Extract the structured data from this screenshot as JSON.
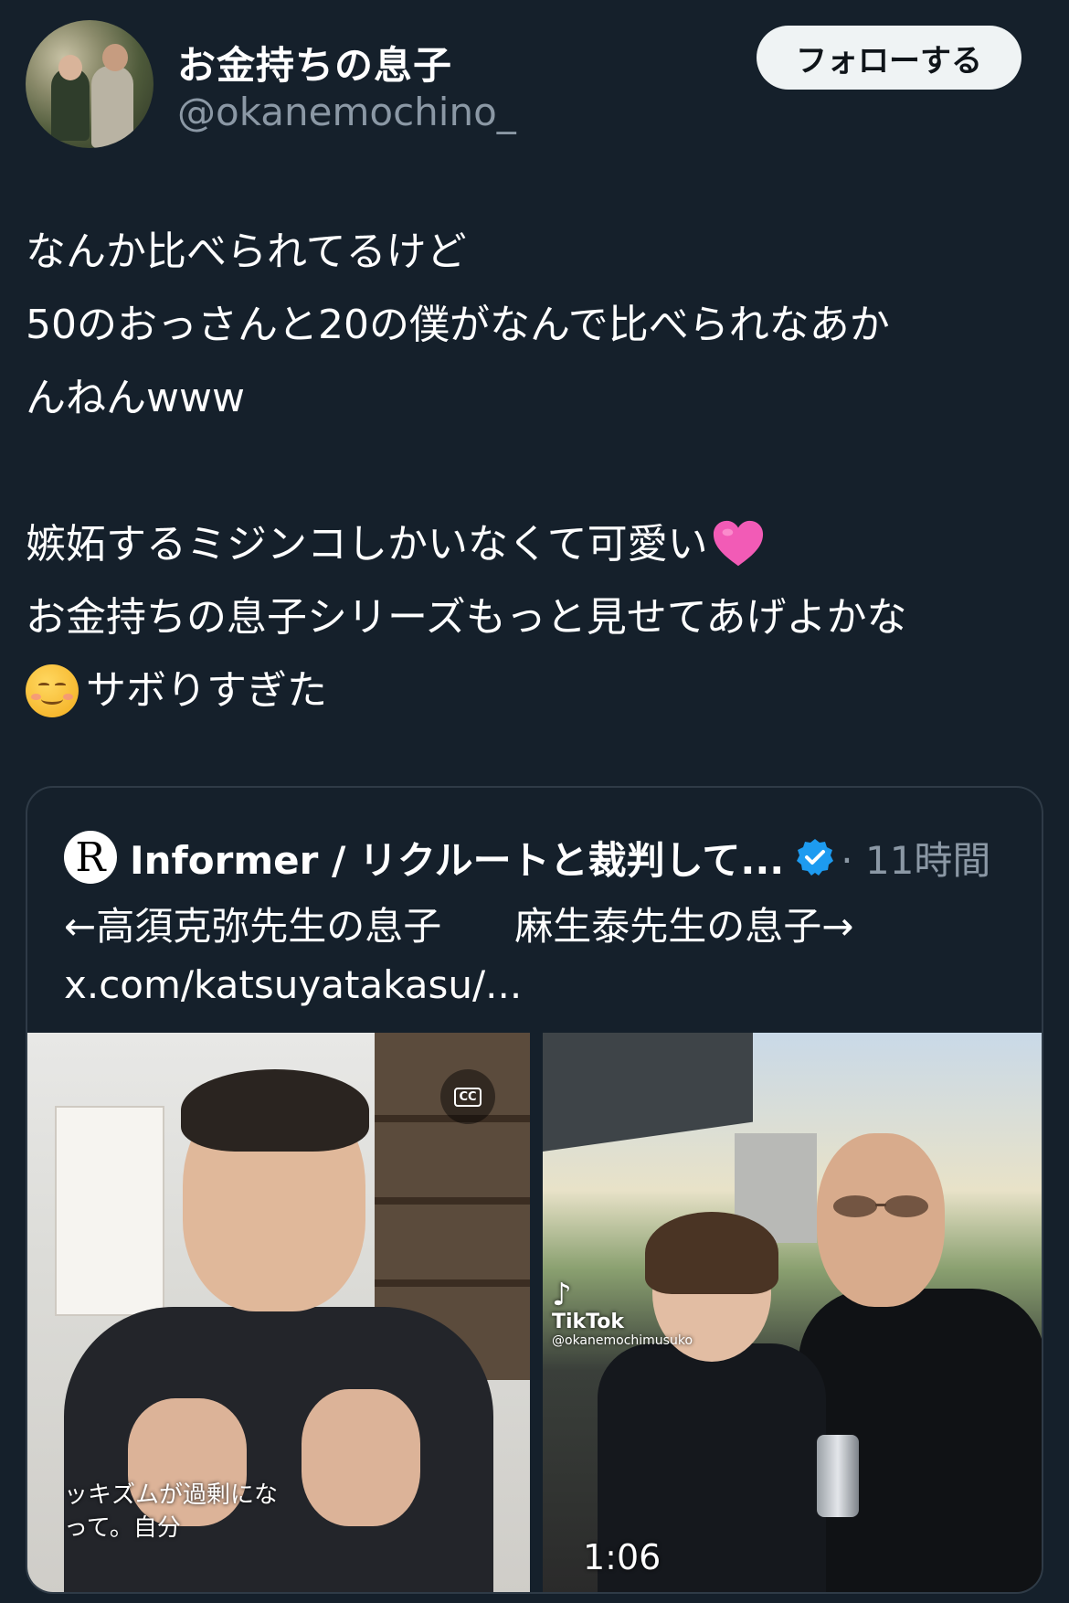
{
  "user": {
    "display_name": "お金持ちの息子",
    "handle": "@okanemochino_",
    "avatar_icon": "profile-photo"
  },
  "follow_button": {
    "label": "フォローする"
  },
  "tweet": {
    "lines": [
      "なんか比べられてるけど",
      "50のおっさんと20の僕がなんで比べられなあか",
      "んねんwww",
      "",
      "嫉妬するミジンコしかいなくて可愛い",
      "お金持ちの息子シリーズもっと見せてあげよかな",
      "サボりすぎた"
    ],
    "emoji_heart": "pink-heart",
    "emoji_smile": "smiling-face"
  },
  "quote": {
    "author": "Informer / リクルートと裁判して...",
    "avatar_letter": "R",
    "verified_icon": "verified-badge",
    "time": "· 11時間",
    "text_left": "←高須克弥先生の息子",
    "text_right": "麻生泰先生の息子→",
    "link": "x.com/katsuyatakasu/..."
  },
  "media": {
    "left": {
      "cc_label": "CC",
      "subtitle": "ッキズムが過剰にな\nって。自分"
    },
    "right": {
      "watermark": "TikTok",
      "watermark_user": "@okanemochimusuko",
      "duration": "1:06"
    }
  },
  "colors": {
    "background": "#15202b",
    "secondary_text": "#8b98a5",
    "verified": "#1d9bf0",
    "heart": "#f25bb6"
  }
}
